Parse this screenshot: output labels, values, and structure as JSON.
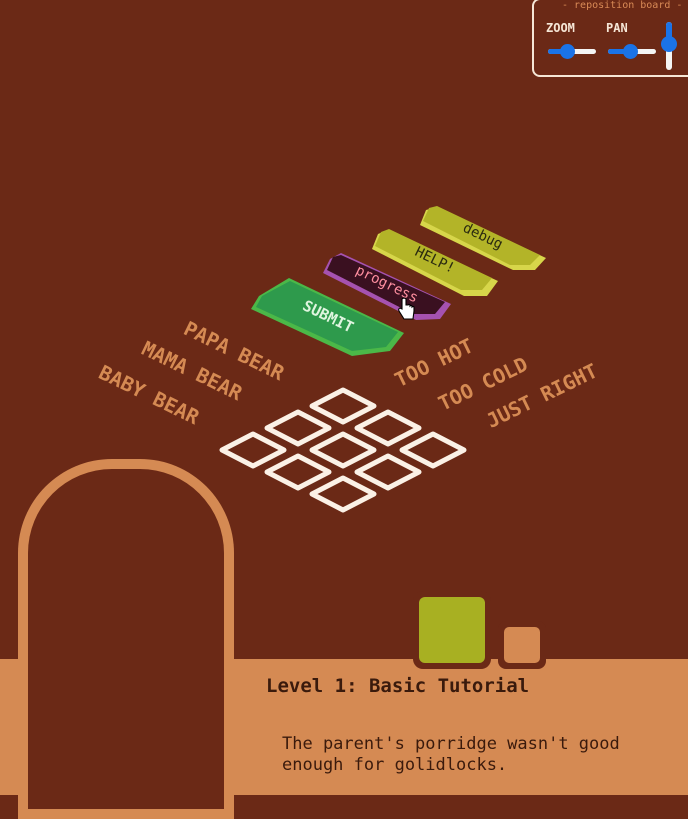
{
  "controls": {
    "title": "- reposition board -",
    "zoom_label": "ZOOM",
    "pan_label": "PAN",
    "zoom_level": 0.4,
    "pan_level": 0.45,
    "vertical_level": 0.45
  },
  "buttons": {
    "submit": "SUBMIT",
    "progress": "progress",
    "help": "HELP!",
    "debug": "debug"
  },
  "row_labels": [
    "PAPA BEAR",
    "MAMA BEAR",
    "BABY BEAR"
  ],
  "col_labels": [
    "TOO HOT",
    "TOO COLD",
    "JUST RIGHT"
  ],
  "grid": {
    "rows": 3,
    "cols": 3
  },
  "level": {
    "title": "Level 1: Basic Tutorial",
    "description": "The parent's porridge wasn't good enough for golidlocks."
  },
  "colors": {
    "background": "#6b2916",
    "accent": "#d58a53",
    "submit": "#2e9a4c",
    "progress": "#3a1020",
    "help": "#b5bd2a",
    "swatch_selected": "#a8b022",
    "swatch_other": "#d58a53"
  },
  "icons": {
    "cursor": "hand-pointer-icon"
  }
}
